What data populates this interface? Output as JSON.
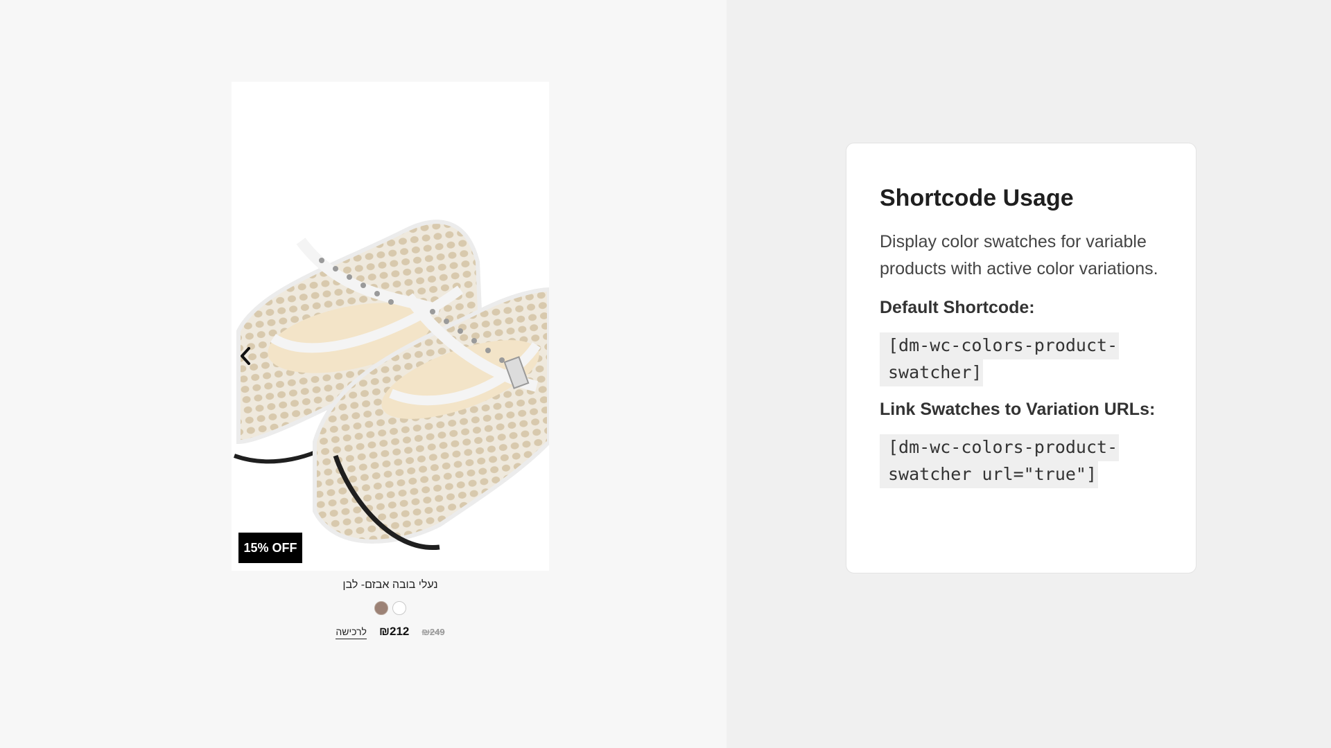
{
  "product": {
    "title": "נעלי בובה אבזם- לבן",
    "badge": "15% OFF",
    "sale_price": "₪212",
    "old_price": "₪249",
    "buy_label": "לרכישה",
    "swatches": [
      {
        "name": "brown",
        "color": "#9c8276"
      },
      {
        "name": "white",
        "color": "#ffffff"
      }
    ]
  },
  "shortcode_box": {
    "title": "Shortcode Usage",
    "description": "Display color swatches for variable products with active color variations.",
    "default_label": "Default Shortcode:",
    "default_code": "[dm-wc-colors-product-swatcher]",
    "link_label": "Link Swatches to Variation URLs:",
    "link_code": "[dm-wc-colors-product-swatcher url=\"true\"]"
  },
  "colors": {
    "left_bg": "#f7f7f7",
    "right_bg": "#f0f0f0",
    "badge_bg": "#000000"
  }
}
